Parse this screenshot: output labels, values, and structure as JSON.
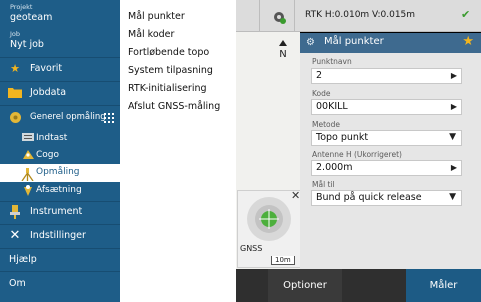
{
  "drawer": {
    "project_label": "Projekt",
    "project_value": "geoteam",
    "job_label": "Job",
    "job_value": "Nyt job",
    "items": [
      {
        "label": "Favorit",
        "icon": "star-icon"
      },
      {
        "label": "Jobdata",
        "icon": "folder-icon"
      },
      {
        "label": "Generel opmåling",
        "icon": "survey-icon"
      },
      {
        "label": "Indtast",
        "icon": "keyboard-icon"
      },
      {
        "label": "Cogo",
        "icon": "cogo-icon"
      },
      {
        "label": "Opmåling",
        "icon": "measure-icon",
        "selected": true
      },
      {
        "label": "Afsætning",
        "icon": "stakeout-icon"
      },
      {
        "label": "Instrument",
        "icon": "instrument-icon"
      },
      {
        "label": "Indstillinger",
        "icon": "settings-icon"
      },
      {
        "label": "Hjælp"
      },
      {
        "label": "Om"
      }
    ]
  },
  "popup_menu": {
    "items": [
      "Mål punkter",
      "Mål koder",
      "Fortløbende topo",
      "System tilpasning",
      "RTK-initialisering",
      "Afslut GNSS-måling"
    ]
  },
  "status_bar": {
    "precision": "RTK H:0.010m V:0.015m",
    "status_icon": "check-icon"
  },
  "map": {
    "north_label": "N",
    "gnss_label": "GNSS",
    "scale_label": "10m"
  },
  "form": {
    "title": "Mål punkter",
    "fields": [
      {
        "label": "Punktnavn",
        "value": "2",
        "control": "arrow"
      },
      {
        "label": "Kode",
        "value": "00KILL",
        "control": "arrow"
      },
      {
        "label": "Metode",
        "value": "Topo punkt",
        "control": "dropdown"
      },
      {
        "label": "Antenne H (Ukorrigeret)",
        "value": "2.000m",
        "control": "arrow"
      },
      {
        "label": "Mål til",
        "value": "Bund på quick release",
        "control": "dropdown"
      }
    ]
  },
  "bottom_bar": {
    "options_label": "Optioner",
    "measure_label": "Måler"
  },
  "colors": {
    "drawer_bg": "#1e5d88",
    "accent_blue": "#3e6a8f",
    "star": "#f2b51f",
    "ok_green": "#3a9b2e"
  }
}
